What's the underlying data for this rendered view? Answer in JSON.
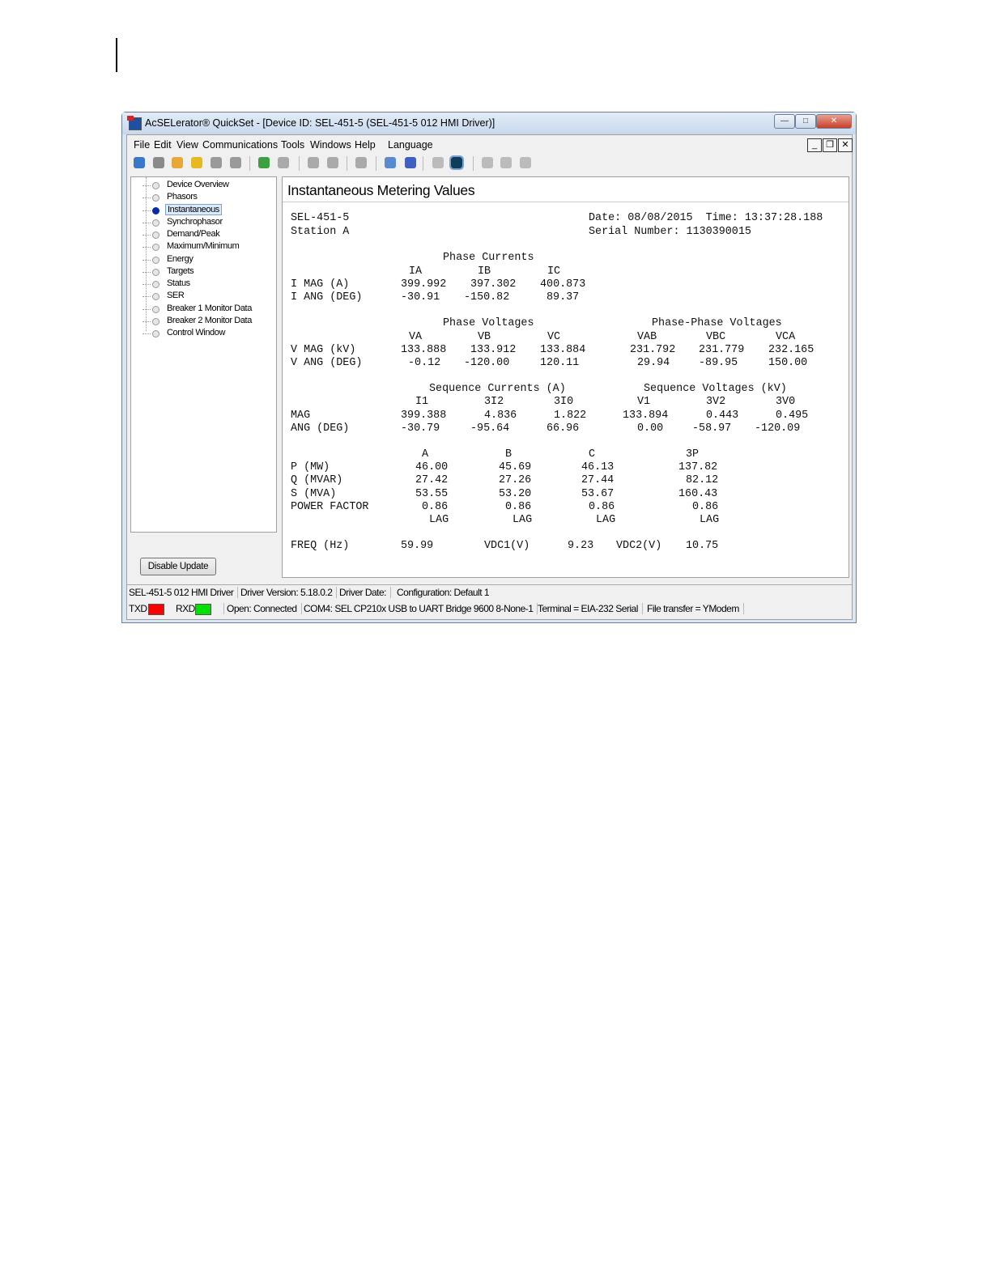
{
  "window": {
    "title": "AcSELerator® QuickSet - [Device ID: SEL-451-5 (SEL-451-5 012 HMI Driver)]",
    "controls": {
      "minimize": "—",
      "maximize": "□",
      "close": "✕"
    },
    "mdi_controls": {
      "minimize": "_",
      "restore": "❐",
      "close": "✕"
    }
  },
  "menu": [
    "File",
    "Edit",
    "View",
    "Communications",
    "Tools",
    "Windows",
    "Help",
    "Language"
  ],
  "toolbar": {
    "icons": [
      "home-icon",
      "settings-gear-icon",
      "new-settings-icon",
      "open-folder-icon",
      "save-icon",
      "save-all-icon",
      "import-icon",
      "export-icon",
      "download-icon",
      "upload-icon",
      "spellcheck-icon",
      "device-connect-icon",
      "device-database-icon",
      "meter-gauge-icon",
      "terminal-icon",
      "edit-doc-icon",
      "report-icon",
      "options-icon"
    ],
    "colors": {
      "folder": "#e8b820",
      "terminal": "#0b3d5c",
      "highlight": "#cfe3f8"
    }
  },
  "tree": {
    "items": [
      "Device Overview",
      "Phasors",
      "Instantaneous",
      "Synchrophasor",
      "Demand/Peak",
      "Maximum/Minimum",
      "Energy",
      "Targets",
      "Status",
      "SER",
      "Breaker 1 Monitor Data",
      "Breaker 2 Monitor Data",
      "Control Window"
    ],
    "selected": "Instantaneous"
  },
  "disable_update": "Disable Update",
  "main": {
    "heading": "Instantaneous Metering Values",
    "rows": [
      [
        "SEL-451-5",
        "Date: 08/08/2015  Time: 13:37:28.188"
      ],
      [
        "Station A",
        "Serial Number: 1130390015"
      ],
      [
        "Phase Currents"
      ],
      [
        "IA",
        "IB",
        "IC"
      ],
      [
        "I MAG (A)",
        "399.992",
        "397.302",
        "400.873"
      ],
      [
        "I ANG (DEG)",
        "-30.91",
        "-150.82",
        "89.37"
      ],
      [
        "Phase Voltages",
        "Phase-Phase Voltages"
      ],
      [
        "VA",
        "VB",
        "VC",
        "VAB",
        "VBC",
        "VCA"
      ],
      [
        "V MAG (kV)",
        "133.888",
        "133.912",
        "133.884",
        "231.792",
        "231.779",
        "232.165"
      ],
      [
        "V ANG (DEG)",
        "-0.12",
        "-120.00",
        "120.11",
        "29.94",
        "-89.95",
        "150.00"
      ],
      [
        "Sequence Currents (A)",
        "Sequence Voltages (kV)"
      ],
      [
        "I1",
        "3I2",
        "3I0",
        "V1",
        "3V2",
        "3V0"
      ],
      [
        "MAG",
        "399.388",
        "4.836",
        "1.822",
        "133.894",
        "0.443",
        "0.495"
      ],
      [
        "ANG (DEG)",
        "-30.79",
        "-95.64",
        "66.96",
        "0.00",
        "-58.97",
        "-120.09"
      ],
      [
        "A",
        "B",
        "C",
        "3P"
      ],
      [
        "P (MW)",
        "46.00",
        "45.69",
        "46.13",
        "137.82"
      ],
      [
        "Q (MVAR)",
        "27.42",
        "27.26",
        "27.44",
        "82.12"
      ],
      [
        "S (MVA)",
        "53.55",
        "53.20",
        "53.67",
        "160.43"
      ],
      [
        "POWER FACTOR",
        "0.86",
        "0.86",
        "0.86",
        "0.86"
      ],
      [
        "LAG",
        "LAG",
        "LAG",
        "LAG"
      ],
      [
        "FREQ (Hz)",
        "59.99",
        "VDC1(V)",
        "9.23",
        "VDC2(V)",
        "10.75"
      ]
    ]
  },
  "status1": [
    "SEL-451-5 012 HMI Driver",
    "Driver Version: 5.18.0.2",
    "Driver Date:",
    "Configuration: Default 1"
  ],
  "status2": {
    "txd": "TXD",
    "rxd": "RXD",
    "txd_color": "#ff0000",
    "rxd_color": "#00e000",
    "cells": [
      "Open: Connected",
      "COM4: SEL CP210x USB to UART Bridge  9600  8-None-1",
      "Terminal = EIA-232 Serial",
      "File transfer = YModem"
    ]
  }
}
